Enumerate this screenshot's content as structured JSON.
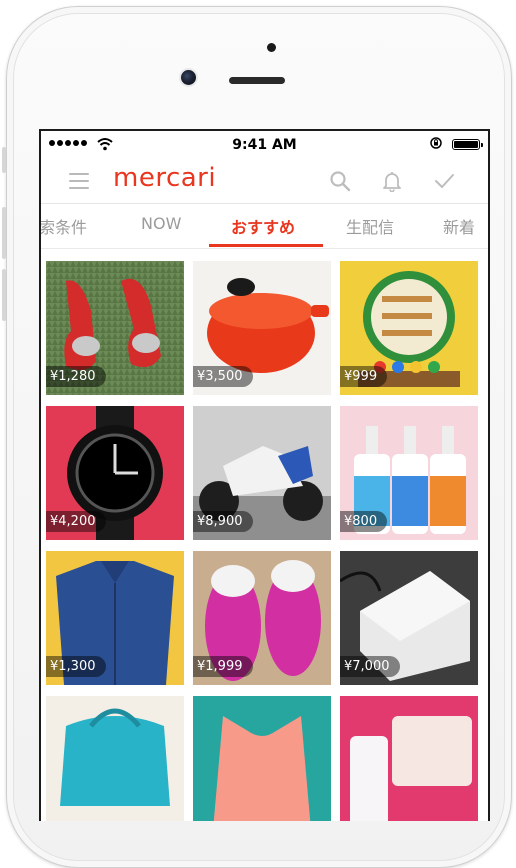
{
  "status_bar": {
    "time": "9:41 AM"
  },
  "app": {
    "brand": "mercari"
  },
  "tabs": [
    {
      "label": "索条件",
      "active": false
    },
    {
      "label": "NOW",
      "active": false
    },
    {
      "label": "おすすめ",
      "active": true
    },
    {
      "label": "生配信",
      "active": false
    },
    {
      "label": "新着",
      "active": false
    }
  ],
  "items": [
    {
      "price": "¥1,280",
      "image": "red heels with bows on grass"
    },
    {
      "price": "¥3,500",
      "image": "orange cast iron pot"
    },
    {
      "price": "¥999",
      "image": "wooden toy with balls"
    },
    {
      "price": "¥4,200",
      "image": "black sport watch"
    },
    {
      "price": "¥8,900",
      "image": "white scooter motorcycle"
    },
    {
      "price": "¥800",
      "image": "colorful soap bottles"
    },
    {
      "price": "¥1,300",
      "image": "blue denim shirt"
    },
    {
      "price": "¥1,999",
      "image": "magenta kids sneakers"
    },
    {
      "price": "¥7,000",
      "image": "white printer device"
    },
    {
      "price": "",
      "image": "turquoise handbag"
    },
    {
      "price": "",
      "image": "coral lace top"
    },
    {
      "price": "",
      "image": "pink cosmetics box"
    }
  ],
  "colors": {
    "accent": "#e8361f",
    "tab_inactive": "#9b9b9b"
  }
}
